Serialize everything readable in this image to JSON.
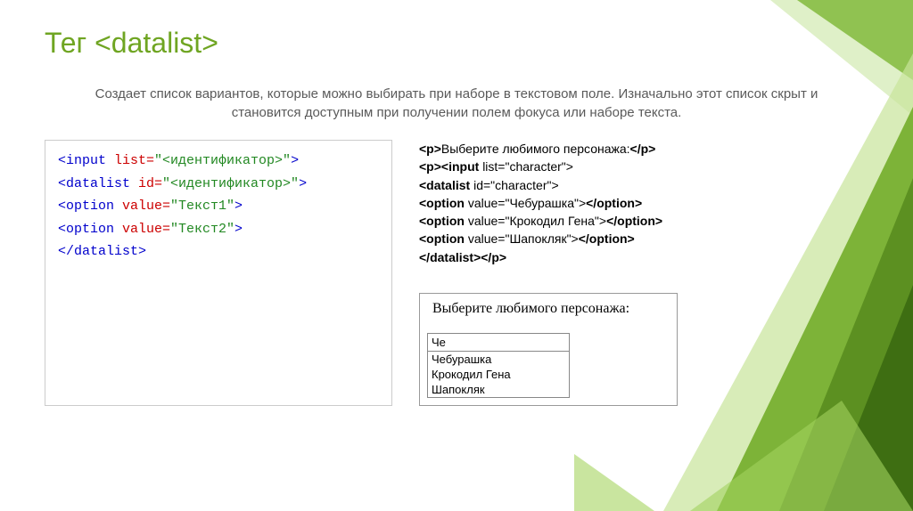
{
  "title": "Тег <datalist>",
  "description": "Создает список вариантов, которые можно выбирать при наборе в текстовом поле. Изначально этот список скрыт и становится доступным при получении полем фокуса или наборе текста.",
  "syntax_code": {
    "line1": {
      "tag_open": "<input ",
      "attr": "list=",
      "val": "\"<идентификатор>\"",
      "tag_close": ">"
    },
    "line2": {
      "tag_open": "<datalist ",
      "attr": "id=",
      "val": "\"<идентификатор>\"",
      "tag_close": ">"
    },
    "line3": {
      "indent": "  ",
      "tag_open": "<option ",
      "attr": "value=",
      "val": "\"Текст1\"",
      "tag_close": ">"
    },
    "line4": {
      "indent": "  ",
      "tag_open": "<option ",
      "attr": "value=",
      "val": "\"Текст2\"",
      "tag_close": ">"
    },
    "line5": {
      "tag": "</datalist>"
    }
  },
  "example_code": {
    "l1_a": "<p>",
    "l1_b": "Выберите любимого персонажа:",
    "l1_c": "</p>",
    "l2_a": "<p><input ",
    "l2_b": "list=\"character\">",
    "l3_a": " <datalist ",
    "l3_b": "id=\"character\">",
    "l4_a": "<option ",
    "l4_b": "value=\"Чебурашка\">",
    "l4_c": "</option>",
    "l5_a": "<option ",
    "l5_b": "value=\"Крокодил Гена\">",
    "l5_c": "</option>",
    "l6_a": "<option ",
    "l6_b": "value=\"Шапокляк\">",
    "l6_c": "</option>",
    "l7_a": "</datalist></p>"
  },
  "preview": {
    "label": "Выберите любимого персонажа:",
    "input_value": "Че",
    "options": [
      "Чебурашка",
      "Крокодил Гена",
      "Шапокляк"
    ]
  }
}
